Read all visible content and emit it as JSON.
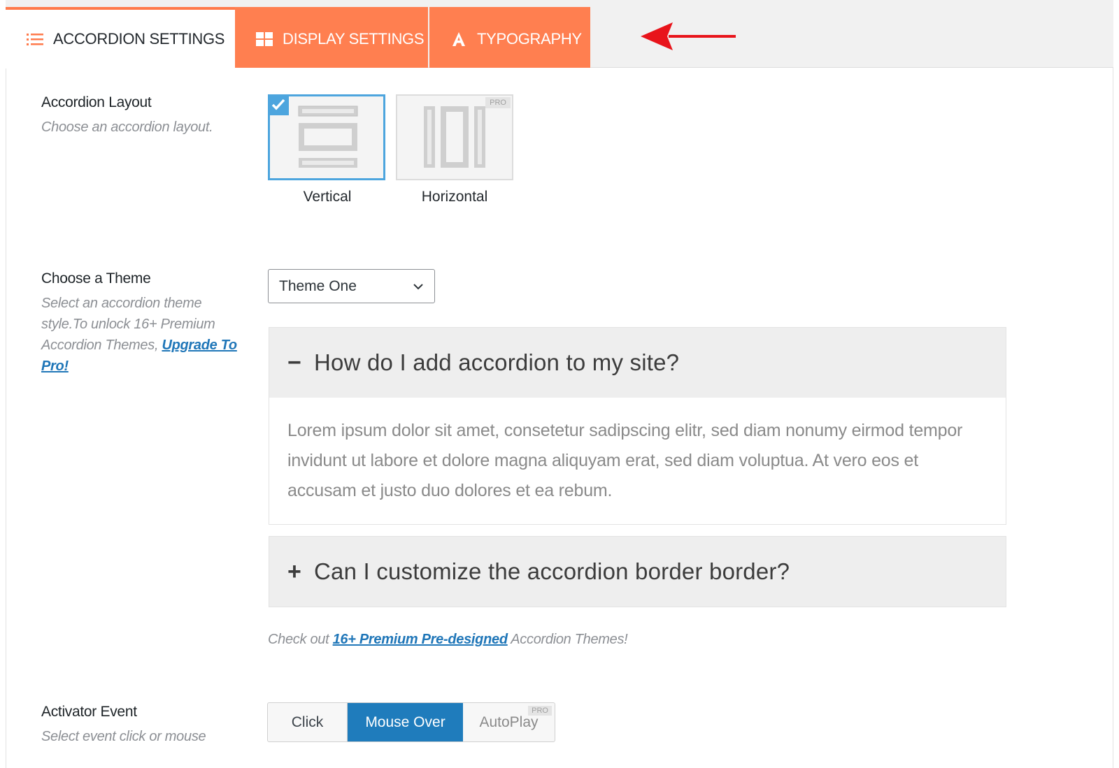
{
  "tabs": [
    {
      "label": "ACCORDION SETTINGS",
      "icon": "list-icon",
      "active": true
    },
    {
      "label": "DISPLAY SETTINGS",
      "icon": "grid-icon",
      "active": false
    },
    {
      "label": "TYPOGRAPHY",
      "icon": "font-icon",
      "active": false
    }
  ],
  "colors": {
    "accent_orange": "#ff7f50",
    "selected_blue": "#4da5de",
    "button_blue": "#1f7cbc",
    "arrow_red": "#e8141b"
  },
  "layout_field": {
    "title": "Accordion Layout",
    "description": "Choose an accordion layout.",
    "options": [
      {
        "label": "Vertical",
        "selected": true,
        "pro": ""
      },
      {
        "label": "Horizontal",
        "selected": false,
        "pro": "PRO"
      }
    ]
  },
  "theme_field": {
    "title": "Choose a Theme",
    "description": "Select an accordion theme style.To unlock 16+ Premium Accordion Themes, ",
    "upgrade_link": "Upgrade To Pro!",
    "selected_theme": "Theme One"
  },
  "preview": {
    "items": [
      {
        "symbol": "−",
        "question": "How do I add accordion to my site?",
        "answer": "Lorem ipsum dolor sit amet, consetetur sadipscing elitr, sed diam nonumy eirmod tempor invidunt ut labore et dolore magna aliquyam erat, sed diam voluptua. At vero eos et accusam et justo duo dolores et ea rebum."
      },
      {
        "symbol": "+",
        "question": "Can I customize the accordion border border?"
      }
    ],
    "note_prefix": "Check out ",
    "note_link": "16+ Premium Pre-designed",
    "note_suffix": " Accordion Themes!"
  },
  "activator_field": {
    "title": "Activator Event",
    "description": "Select event click or mouse",
    "buttons": [
      {
        "label": "Click",
        "active": false
      },
      {
        "label": "Mouse Over",
        "active": true
      },
      {
        "label": "AutoPlay",
        "active": false,
        "pro": "PRO"
      }
    ]
  }
}
